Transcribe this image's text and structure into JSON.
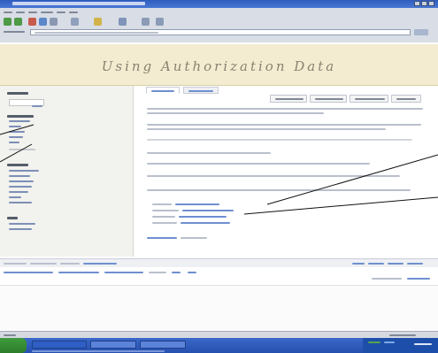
{
  "wiki": {
    "banner_title": "Using Authorization Data"
  },
  "colors": {
    "title_bar": "#2f5dbf",
    "banner_bg": "#f3ecd0",
    "sidebar_bg": "#f2f2ee",
    "taskbar": "#2650b0",
    "start_button": "#3f9b3d",
    "annotation_arrow": "#111111"
  },
  "icons": [
    "back-icon",
    "forward-icon",
    "stop-icon",
    "refresh-icon",
    "home-icon",
    "search-icon",
    "favorites-icon",
    "history-icon",
    "mail-icon",
    "print-icon",
    "start-icon"
  ]
}
